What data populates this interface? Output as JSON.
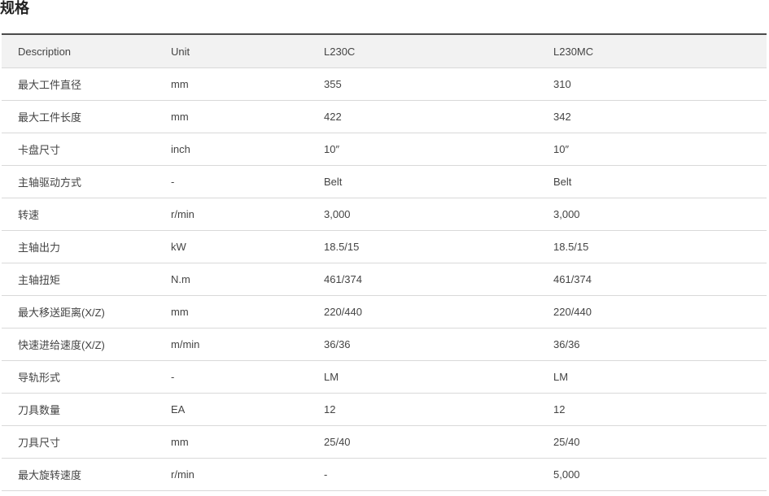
{
  "page": {
    "title": "规格"
  },
  "table": {
    "headers": [
      "Description",
      "Unit",
      "L230C",
      "L230MC"
    ],
    "rows": [
      [
        "最大工件直径",
        "mm",
        "355",
        "310"
      ],
      [
        "最大工件长度",
        "mm",
        "422",
        "342"
      ],
      [
        "卡盘尺寸",
        "inch",
        "10″",
        "10″"
      ],
      [
        "主轴驱动方式",
        "-",
        "Belt",
        "Belt"
      ],
      [
        "转速",
        "r/min",
        "3,000",
        "3,000"
      ],
      [
        "主轴出力",
        "kW",
        "18.5/15",
        "18.5/15"
      ],
      [
        "主轴扭矩",
        "N.m",
        "461/374",
        "461/374"
      ],
      [
        "最大移送距离(X/Z)",
        "mm",
        "220/440",
        "220/440"
      ],
      [
        "快速进给速度(X/Z)",
        "m/min",
        "36/36",
        "36/36"
      ],
      [
        "导轨形式",
        "-",
        "LM",
        "LM"
      ],
      [
        "刀具数量",
        "EA",
        "12",
        "12"
      ],
      [
        "刀具尺寸",
        "mm",
        "25/40",
        "25/40"
      ],
      [
        "最大旋转速度",
        "r/min",
        "-",
        "5,000"
      ]
    ]
  }
}
